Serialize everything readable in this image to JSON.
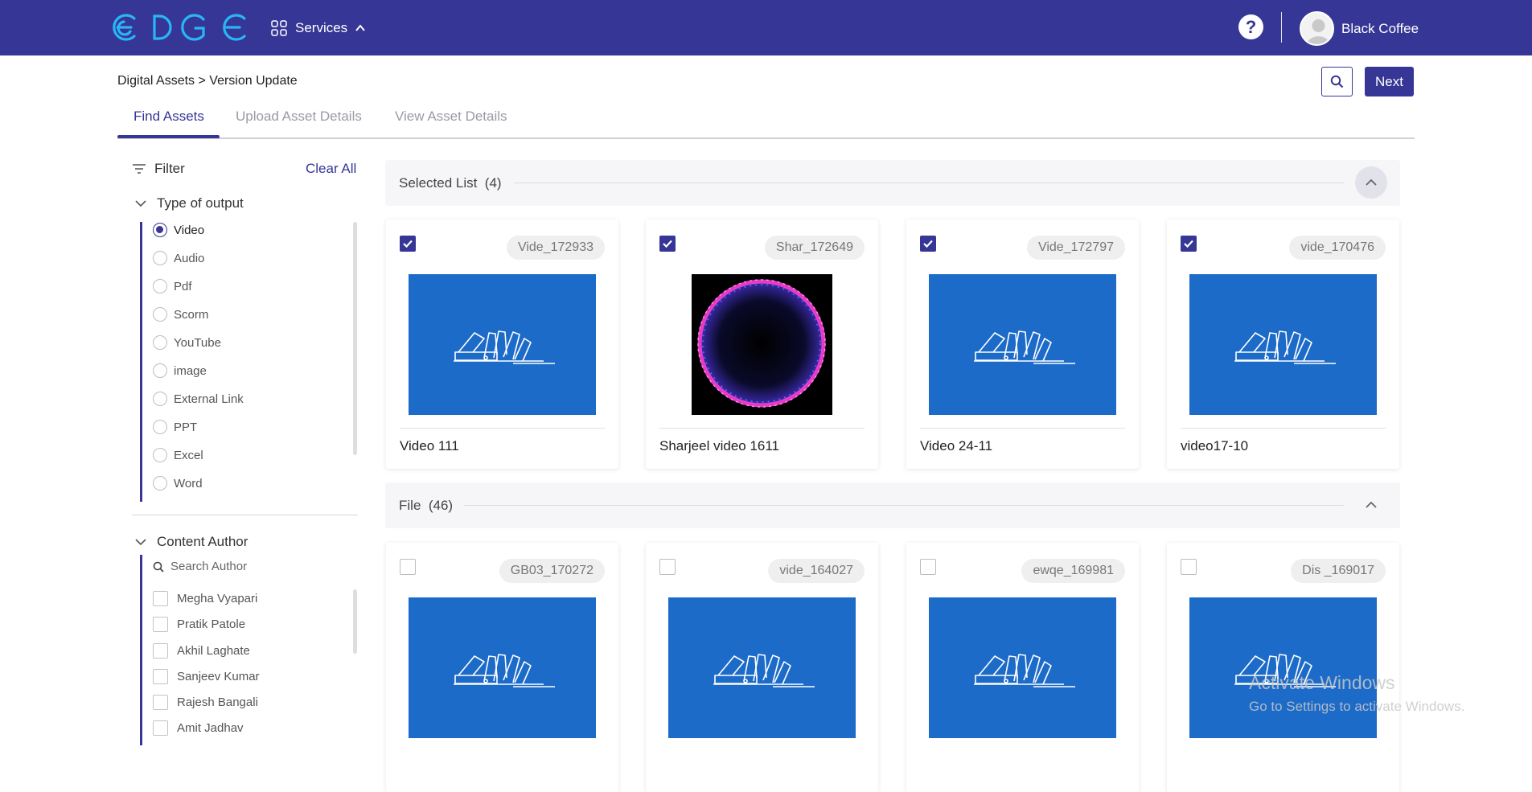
{
  "app": {
    "logo_text": "EDGE",
    "services_label": "Services",
    "help_label": "?",
    "user_name": "Black Coffee",
    "accent_color": "#363696",
    "thumb_color": "#1d6bc8"
  },
  "header": {
    "breadcrumb": "Digital Assets > Version Update",
    "next_label": "Next",
    "tabs": [
      {
        "label": "Find Assets",
        "active": true
      },
      {
        "label": "Upload Asset Details",
        "active": false
      },
      {
        "label": "View Asset Details",
        "active": false
      }
    ]
  },
  "filter": {
    "title": "Filter",
    "clear_all": "Clear All",
    "type_of_output": {
      "title": "Type of output",
      "options": [
        {
          "label": "Video",
          "selected": true
        },
        {
          "label": "Audio",
          "selected": false
        },
        {
          "label": "Pdf",
          "selected": false
        },
        {
          "label": "Scorm",
          "selected": false
        },
        {
          "label": "YouTube",
          "selected": false
        },
        {
          "label": "image",
          "selected": false
        },
        {
          "label": "External Link",
          "selected": false
        },
        {
          "label": "PPT",
          "selected": false
        },
        {
          "label": "Excel",
          "selected": false
        },
        {
          "label": "Word",
          "selected": false
        }
      ]
    },
    "content_author": {
      "title": "Content Author",
      "search_placeholder": "Search Author",
      "authors": [
        {
          "label": "Megha Vyapari",
          "checked": false
        },
        {
          "label": "Pratik Patole",
          "checked": false
        },
        {
          "label": "Akhil Laghate",
          "checked": false
        },
        {
          "label": "Sanjeev Kumar",
          "checked": false
        },
        {
          "label": "Rajesh Bangali",
          "checked": false
        },
        {
          "label": "Amit Jadhav",
          "checked": false
        }
      ]
    }
  },
  "selected_list": {
    "title": "Selected List",
    "count": "(4)",
    "cards": [
      {
        "id": "Vide_172933",
        "title": "Video 111",
        "checked": true,
        "thumb": "library-icon"
      },
      {
        "id": "Shar_172649",
        "title": "Sharjeel video 1611",
        "checked": true,
        "thumb": "glowing-ring"
      },
      {
        "id": "Vide_172797",
        "title": "Video 24-11",
        "checked": true,
        "thumb": "library-icon"
      },
      {
        "id": "vide_170476",
        "title": "video17-10",
        "checked": true,
        "thumb": "library-icon"
      }
    ]
  },
  "file_list": {
    "title": "File",
    "count": "(46)",
    "cards": [
      {
        "id": "GB03_170272",
        "checked": false,
        "thumb": "library-icon"
      },
      {
        "id": "vide_164027",
        "checked": false,
        "thumb": "library-icon"
      },
      {
        "id": "ewqe_169981",
        "checked": false,
        "thumb": "library-icon"
      },
      {
        "id": "Dis _169017",
        "checked": false,
        "thumb": "library-icon"
      }
    ]
  },
  "watermark": {
    "line1": "Activate Windows",
    "line2": "Go to Settings to activate Windows."
  }
}
